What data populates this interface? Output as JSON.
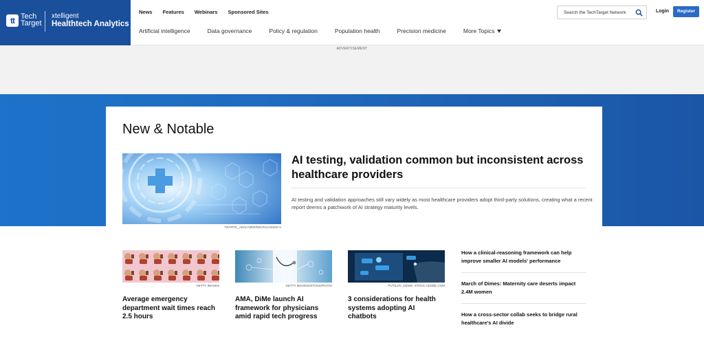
{
  "header": {
    "brand_mark": "tt",
    "brand_line1": "Tech",
    "brand_line2": "Target",
    "brand_sub": "xtelligent",
    "site_name": "Healthtech Analytics",
    "top_nav": [
      "News",
      "Features",
      "Webinars",
      "Sponsored Sites"
    ],
    "main_nav": [
      "Artificial intelligence",
      "Data governance",
      "Policy & regulation",
      "Population health",
      "Precision medicine"
    ],
    "more_topics": "More Topics",
    "search_placeholder": "Search the TechTarget Network",
    "login": "Login",
    "register": "Register"
  },
  "ad": {
    "label": "ADVERTISEMENT"
  },
  "section": {
    "title": "New & Notable",
    "hero": {
      "title": "AI testing, validation common but inconsistent across healthcare providers",
      "summary": "AI testing and validation approaches still vary widely as most healthcare providers adopt third-party solutions, creating what a recent report deems a patchwork of AI strategy maturity levels.",
      "credit": "TRAFFIC_ANALYZER/DIGITALVISION V"
    }
  },
  "cards": [
    {
      "title": "Average emergency department wait times reach 2.5 hours",
      "credit": "GETTY IMAGES"
    },
    {
      "title": "AMA, DiMe launch AI framework for physicians amid rapid tech progress",
      "credit": "GETTY IMAGES/ISTOCKPHOTO"
    },
    {
      "title": "3 considerations for health systems adopting AI chatbots",
      "credit": "PUTILOV_DENIS- STOCK.ADOBE.COM"
    }
  ],
  "sidelist": [
    "How a clinical-reasoning framework can help improve smaller AI models' performance",
    "March of Dimes: Maternity care deserts impact 2.4M women",
    "How a cross-sector collab seeks to bridge rural healthcare's AI divide"
  ],
  "colors": {
    "brand": "#1a4f9c",
    "band": "#1f6bbf",
    "register": "#2a6bc5"
  }
}
